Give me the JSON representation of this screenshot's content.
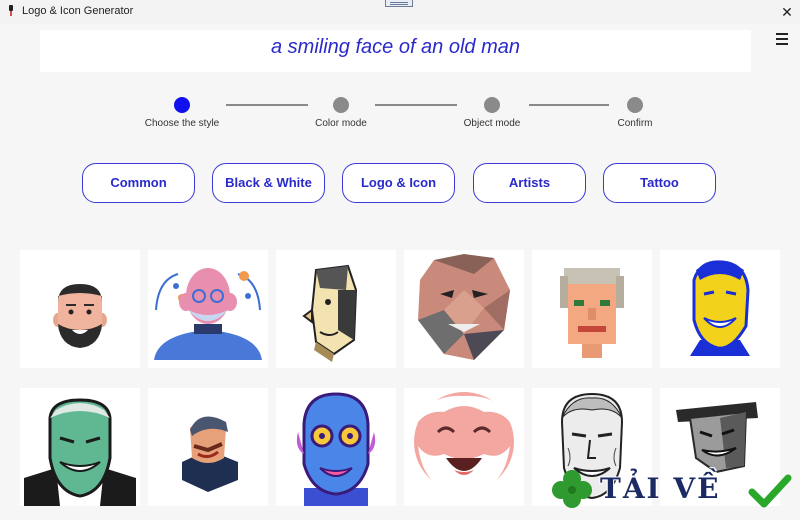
{
  "window": {
    "title": "Logo & Icon Generator",
    "close_glyph": "✕"
  },
  "prompt": {
    "text": "a smiling face of an old man"
  },
  "steps": [
    {
      "label": "Choose the style",
      "active": true
    },
    {
      "label": "Color mode",
      "active": false
    },
    {
      "label": "Object mode",
      "active": false
    },
    {
      "label": "Confirm",
      "active": false
    }
  ],
  "style_buttons": [
    "Common",
    "Black & White",
    "Logo & Icon",
    "Artists",
    "Tattoo"
  ],
  "gallery": [
    "cartoon-bearded-man",
    "flat-illustration-old-man-pink",
    "cubist-profile-old-man",
    "low-poly-old-man",
    "pixel-art-old-man",
    "pop-art-yellow-blue-face",
    "green-grinning-vampire",
    "isometric-man-with-cap",
    "blue-purple-old-man-glasses",
    "laughing-old-man-white-beard",
    "sketch-old-man-portrait",
    "grayscale-grinning-man-hat"
  ],
  "watermark": {
    "text": "TẢI VỀ"
  },
  "colors": {
    "accent": "#1010ee",
    "button_border": "#3a3ad8",
    "button_text": "#2a2acc",
    "inactive_step": "#8a8a8a"
  }
}
